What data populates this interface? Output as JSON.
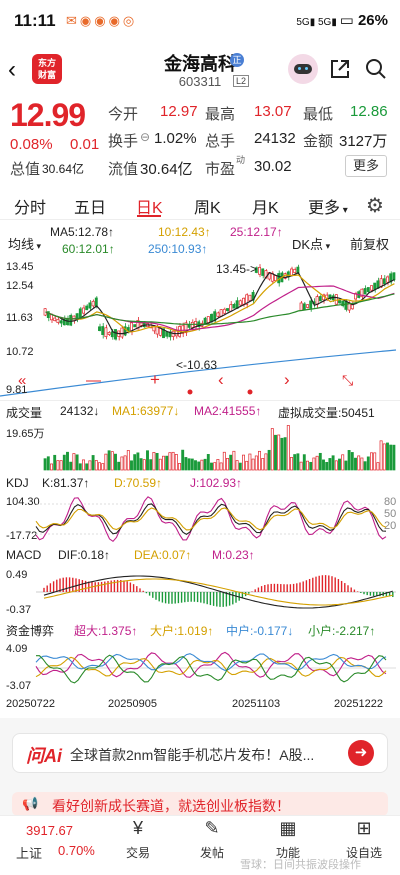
{
  "status": {
    "time": "11:11",
    "battery": "26%",
    "signal": "5G 5G"
  },
  "header": {
    "name": "金海高科",
    "code": "603311",
    "badge": "正",
    "level": "L2",
    "logo_line1": "东方",
    "logo_line2": "财富"
  },
  "quote": {
    "price": "12.99",
    "change_pct": "0.08%",
    "change": "0.01",
    "open_label": "今开",
    "open": "12.97",
    "high_label": "最高",
    "high": "13.07",
    "low_label": "最低",
    "low": "12.86",
    "turnover_label": "换手",
    "turnover": "1.02%",
    "volume_label": "总手",
    "volume": "24132",
    "amount_label": "金额",
    "amount": "3127万",
    "mcap_label": "总值",
    "mcap": "30.64亿",
    "float_label": "流值",
    "float": "30.64亿",
    "pe_label": "市盈",
    "pe_tag": "动",
    "pe": "30.02",
    "more": "更多"
  },
  "tabs": [
    "分时",
    "五日",
    "日K",
    "周K",
    "月K",
    "更多"
  ],
  "chart": {
    "toolbar": {
      "line_type": "均线",
      "dk": "DK点",
      "adjust": "前复权"
    },
    "ma": {
      "ma5": "MA5:12.78↑",
      "ma10": "10:12.43↑",
      "ma25": "25:12.17↑",
      "ma60": "60:12.01↑",
      "ma250": "250:10.93↑"
    },
    "yticks": [
      "13.45",
      "12.54",
      "11.63",
      "10.72",
      "9.81"
    ],
    "annotations": {
      "high": "13.45->",
      "low": "<-10.63"
    },
    "volume": {
      "label": "成交量",
      "value": "24132↓",
      "ma1": "MA1:63977↓",
      "ma2": "MA2:41555↑",
      "virtual": "虚拟成交量:50451",
      "ymax": "19.65万"
    },
    "kdj": {
      "label": "KDJ",
      "k": "K:81.37↑",
      "d": "D:70.59↑",
      "j": "J:102.93↑",
      "ymax": "104.30",
      "ymin": "-17.72",
      "r1": "80",
      "r2": "50",
      "r3": "20"
    },
    "macd": {
      "label": "MACD",
      "dif": "DIF:0.18↑",
      "dea": "DEA:0.07↑",
      "m": "M:0.23↑",
      "ymax": "0.49",
      "ymin": "-0.37"
    },
    "funds": {
      "label": "资金博弈",
      "super": "超大:1.375↑",
      "big": "大户:1.019↑",
      "mid": "中户:-0.177↓",
      "small": "小户:-2.217↑",
      "ymax": "4.09",
      "ymin": "-3.07"
    },
    "xticks": [
      "20250722",
      "20250905",
      "20251103",
      "20251222"
    ]
  },
  "ai": {
    "logo": "问Ai",
    "text": "全球首款2nm智能手机芯片发布！A股..."
  },
  "banner": {
    "text": "看好创新成长赛道，就选创业板指数！"
  },
  "nav": {
    "index_name": "上证",
    "index_value": "3917.67",
    "index_change": "0.70%",
    "items": [
      "交易",
      "发帖",
      "功能",
      "设自选"
    ]
  },
  "watermark": "雪球：日间共振波段操作",
  "colors": {
    "up": "#e0242a",
    "down": "#1a9a3a",
    "ma5": "#222222",
    "ma10": "#d4a000",
    "ma25": "#c0208a",
    "ma60": "#2a8a2a",
    "ma250": "#3a8ad4"
  }
}
